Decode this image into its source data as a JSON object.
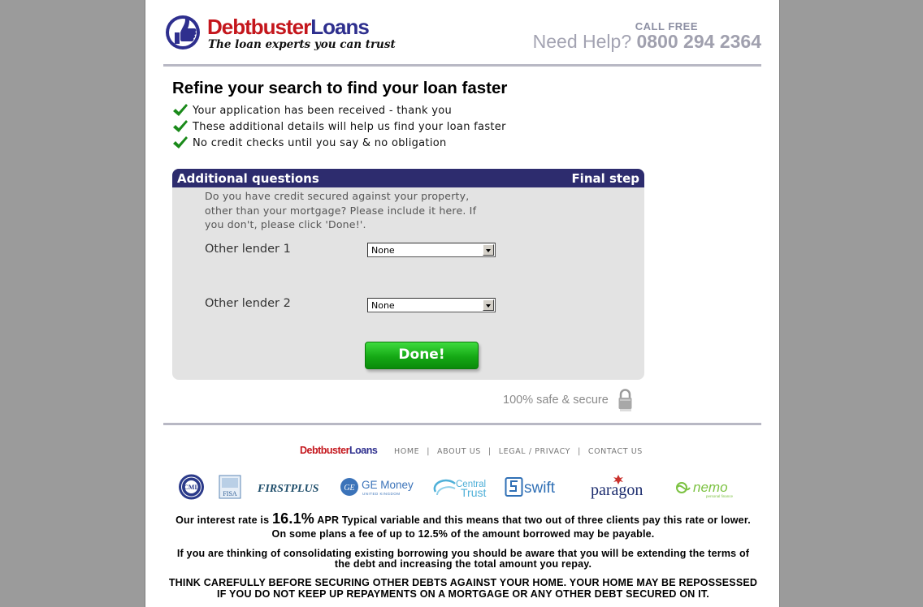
{
  "header": {
    "brand_part1": "Debtbuster",
    "brand_part2": "Loans",
    "tagline": "The loan experts you can trust",
    "call_free": "CALL FREE",
    "need_help": "Need Help?",
    "phone": "0800 294 2364"
  },
  "intro": {
    "headline": "Refine your search to find your loan faster",
    "checks": [
      "Your application has been received - thank you",
      "These additional details will help us find your loan faster",
      "No credit checks until you say & no obligation"
    ]
  },
  "form": {
    "title": "Additional questions",
    "step": "Final step",
    "intro": "Do you have credit secured against your property, other than your mortgage? Please include it here. If you don't, please click 'Done!'.",
    "lenders": [
      {
        "label": "Other lender 1",
        "value": "None"
      },
      {
        "label": "Other lender 2",
        "value": "None"
      }
    ],
    "done_label": "Done!"
  },
  "secure_text": "100% safe & secure",
  "footer": {
    "brand_part1": "Debtbuster",
    "brand_part2": "Loans",
    "nav": [
      "HOME",
      "ABOUT US",
      "LEGAL / PRIVACY",
      "CONTACT US"
    ],
    "partners": [
      "FIRSTPLUS",
      "GE Money",
      "UNITED KINGDOM",
      "Central",
      "Trust",
      "swift",
      "paragon",
      "nemo",
      "personal finance",
      "FISA"
    ],
    "apr_pre": "Our interest rate is",
    "apr_rate": "16.1%",
    "apr_post": "APR Typical variable and this means that two out of three clients pay this rate or lower.",
    "fee_line": "On some plans a fee of up to 12.5% of the amount borrowed may be payable.",
    "consolidate_line1": "If you are thinking of consolidating existing borrowing you should be aware that you will be extending the terms of",
    "consolidate_line2": "the debt and increasing the total amount you repay.",
    "warning_line1": "THINK CAREFULLY BEFORE SECURING OTHER DEBTS AGAINST YOUR HOME. YOUR HOME MAY BE REPOSSESSED",
    "warning_line2": "IF YOU DO NOT KEEP UP REPAYMENTS ON A MORTGAGE OR ANY OTHER DEBT SECURED ON IT."
  },
  "colors": {
    "brand_red": "#c4161c",
    "brand_navy": "#2e2f8e",
    "panel_header": "#2d2c6e",
    "done_green": "#15a915",
    "check_green": "#1a8a1a"
  }
}
